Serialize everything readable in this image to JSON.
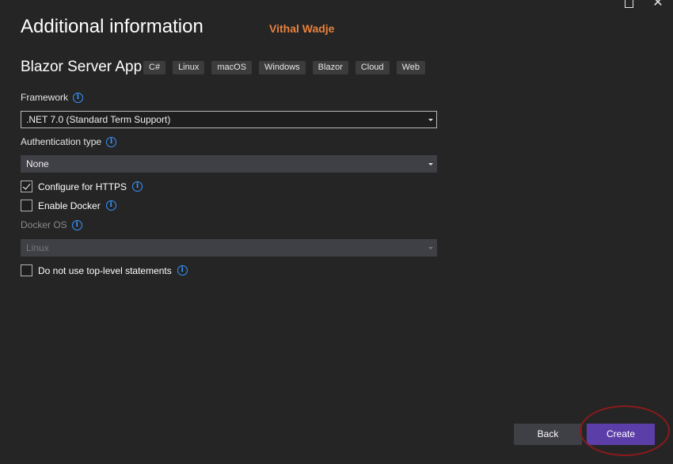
{
  "window": {
    "maximize_icon": "maximize-icon",
    "close_icon": "close-icon",
    "close_glyph": "✕"
  },
  "header": {
    "title": "Additional information",
    "watermark": "Vithal Wadje"
  },
  "project": {
    "name": "Blazor Server App",
    "tags": [
      "C#",
      "Linux",
      "macOS",
      "Windows",
      "Blazor",
      "Cloud",
      "Web"
    ]
  },
  "framework": {
    "label": "Framework",
    "value": ".NET 7.0 (Standard Term Support)"
  },
  "auth": {
    "label": "Authentication type",
    "value": "None"
  },
  "https": {
    "label": "Configure for HTTPS",
    "checked": true
  },
  "docker": {
    "label": "Enable Docker",
    "checked": false
  },
  "docker_os": {
    "label": "Docker OS",
    "value": "Linux",
    "disabled": true
  },
  "top_level": {
    "label": "Do not use top-level statements",
    "checked": false
  },
  "info_glyph": "i",
  "buttons": {
    "back": "Back",
    "create": "Create"
  },
  "colors": {
    "background": "#252526",
    "accent": "#5c3ea8",
    "watermark": "#e8813b",
    "annotation": "#8b1a1a",
    "info": "#3794ff"
  }
}
